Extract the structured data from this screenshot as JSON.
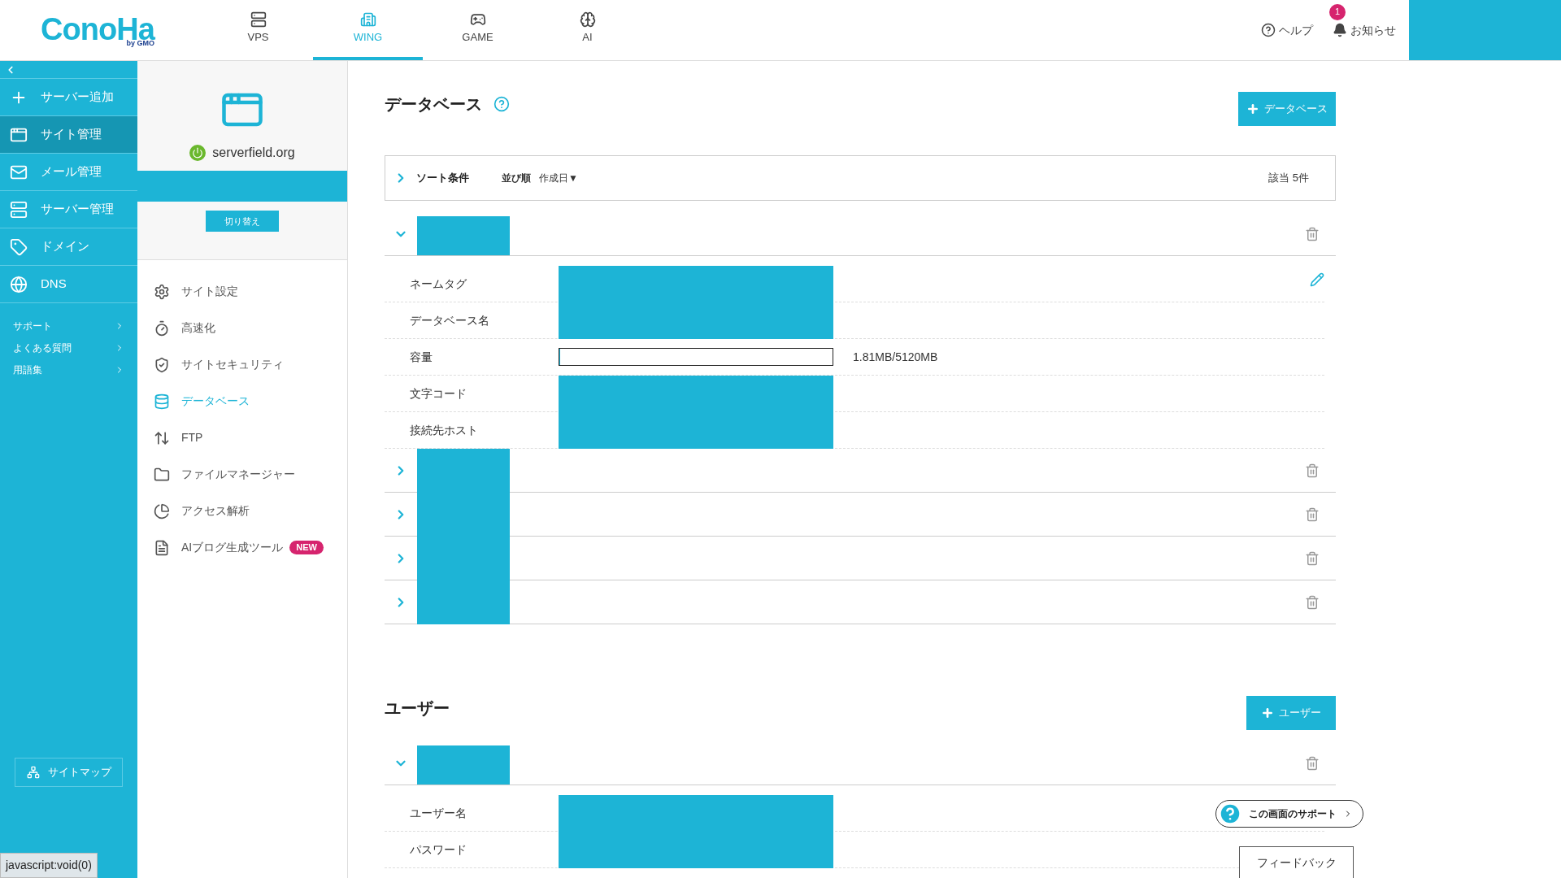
{
  "header": {
    "logo": "ConoHa",
    "logo_sub": "by GMO",
    "tabs": [
      {
        "label": "VPS",
        "selected": false
      },
      {
        "label": "WING",
        "selected": true
      },
      {
        "label": "GAME",
        "selected": false
      },
      {
        "label": "AI",
        "selected": false
      }
    ],
    "help": "ヘルプ",
    "notifications": {
      "label": "お知らせ",
      "badge": "1"
    }
  },
  "sidebar": {
    "items": [
      {
        "label": "サーバー追加",
        "selected": false
      },
      {
        "label": "サイト管理",
        "selected": true
      },
      {
        "label": "メール管理",
        "selected": false
      },
      {
        "label": "サーバー管理",
        "selected": false
      },
      {
        "label": "ドメイン",
        "selected": false
      },
      {
        "label": "DNS",
        "selected": false
      }
    ],
    "links": [
      "サポート",
      "よくある質問",
      "用語集"
    ],
    "sitemap": "サイトマップ"
  },
  "site_panel": {
    "domain": "serverfield.org",
    "switch_button": "切り替え",
    "menu": [
      {
        "label": "サイト設定",
        "selected": false
      },
      {
        "label": "高速化",
        "selected": false
      },
      {
        "label": "サイトセキュリティ",
        "selected": false
      },
      {
        "label": "データベース",
        "selected": true
      },
      {
        "label": "FTP",
        "selected": false
      },
      {
        "label": "ファイルマネージャー",
        "selected": false
      },
      {
        "label": "アクセス解析",
        "selected": false
      },
      {
        "label": "AIブログ生成ツール",
        "selected": false,
        "badge": "NEW"
      }
    ]
  },
  "database": {
    "title": "データベース",
    "add_button": "データベース",
    "sort": {
      "label": "ソート条件",
      "order_label": "並び順",
      "order_value": "作成日▼",
      "count": "該当 5件"
    },
    "rows": [
      {
        "expanded": true,
        "details": [
          {
            "label": "ネームタグ",
            "kind": "hidden"
          },
          {
            "label": "データベース名",
            "kind": "hidden"
          },
          {
            "label": "容量",
            "kind": "meter",
            "level": 0.0004,
            "reading": "1.81MB/5120MB"
          },
          {
            "label": "文字コード",
            "kind": "hidden"
          },
          {
            "label": "接続先ホスト",
            "kind": "hidden"
          }
        ]
      },
      {
        "expanded": false,
        "details": []
      },
      {
        "expanded": false,
        "details": []
      },
      {
        "expanded": false,
        "details": []
      },
      {
        "expanded": false,
        "details": []
      }
    ]
  },
  "users": {
    "title": "ユーザー",
    "add_button": "ユーザー",
    "rows": [
      {
        "expanded": true,
        "details": [
          {
            "label": "ユーザー名",
            "kind": "hidden"
          },
          {
            "label": "パスワード",
            "kind": "hidden"
          }
        ]
      }
    ]
  },
  "support_button": "この画面のサポート",
  "feedback_button": "フィードバック",
  "status_text": "javascript:void(0)"
}
